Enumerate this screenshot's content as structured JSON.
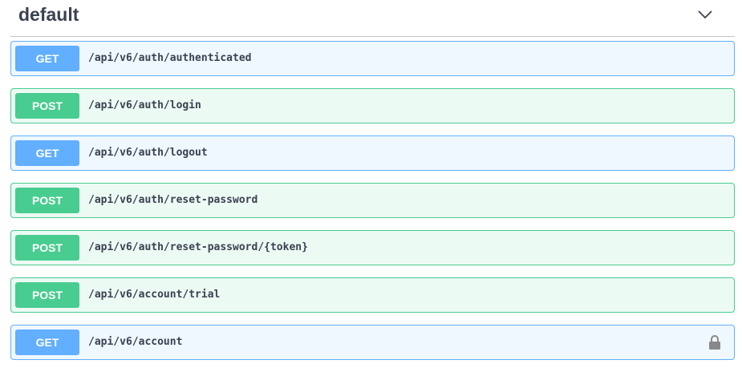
{
  "section": {
    "title": "default",
    "expand_icon": "chevron-down-icon"
  },
  "operations": [
    {
      "method": "GET",
      "path": "/api/v6/auth/authenticated",
      "locked": false
    },
    {
      "method": "POST",
      "path": "/api/v6/auth/login",
      "locked": false
    },
    {
      "method": "GET",
      "path": "/api/v6/auth/logout",
      "locked": false
    },
    {
      "method": "POST",
      "path": "/api/v6/auth/reset-password",
      "locked": false
    },
    {
      "method": "POST",
      "path": "/api/v6/auth/reset-password/{token}",
      "locked": false
    },
    {
      "method": "POST",
      "path": "/api/v6/account/trial",
      "locked": false
    },
    {
      "method": "GET",
      "path": "/api/v6/account",
      "locked": true,
      "lock_icon": "lock-icon"
    }
  ],
  "colors": {
    "get": "#61affe",
    "post": "#49cc90",
    "text": "#3b4151",
    "lock": "#888888"
  }
}
